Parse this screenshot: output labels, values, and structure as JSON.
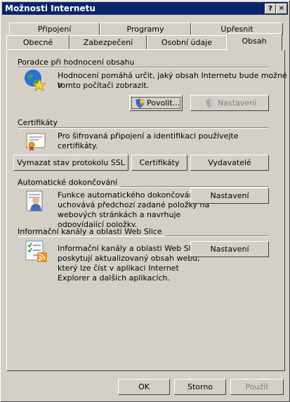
{
  "window": {
    "title": "Možnosti Internetu",
    "help_label": "?",
    "close_label": "✕"
  },
  "tabs_row1": [
    "Připojení",
    "Programy",
    "Upřesnit"
  ],
  "tabs_row2": [
    "Obecné",
    "Zabezpečení",
    "Osobní údaje",
    "Obsah"
  ],
  "content_advisor": {
    "heading": "Poradce při hodnocení obsahu",
    "description_line1": "Hodnocení pomáhá určit, jaký obsah Internetu bude možné v",
    "description_line2": "tomto počítači zobrazit.",
    "enable_label": "Povolit...",
    "settings_label": "Nastavení"
  },
  "certificates": {
    "heading": "Certifikáty",
    "description_line1": "Pro šifrovaná připojení a identifikaci používejte",
    "description_line2": "certifikáty.",
    "clear_ssl_label": "Vymazat stav protokolu SSL",
    "certificates_label": "Certifikáty",
    "publishers_label": "Vydavatelé"
  },
  "autocomplete": {
    "heading": "Automatické dokončování",
    "description_lines": [
      "Funkce automatického dokončování",
      "uchovává předchozí zadané položky na",
      "webových stránkách a navrhuje",
      "odpovídající položky."
    ],
    "settings_label": "Nastavení"
  },
  "feeds": {
    "heading": "Informační kanály a oblasti Web Slice",
    "description_lines": [
      "Informační kanály a oblasti Web Slice",
      "poskytují aktualizovaný obsah webů,",
      "který lze číst v aplikaci Internet",
      "Explorer a dalších aplikacích."
    ],
    "settings_label": "Nastavení"
  },
  "footer": {
    "ok_label": "OK",
    "cancel_label": "Storno",
    "apply_label": "Použít"
  },
  "colors": {
    "titlebar": "#0a246a",
    "face": "#d4d0c8",
    "disabled_text": "#808080"
  },
  "icons": [
    "globe-star-icon",
    "shield-icon",
    "certificate-icon",
    "autocomplete-person-icon",
    "feeds-icon"
  ]
}
